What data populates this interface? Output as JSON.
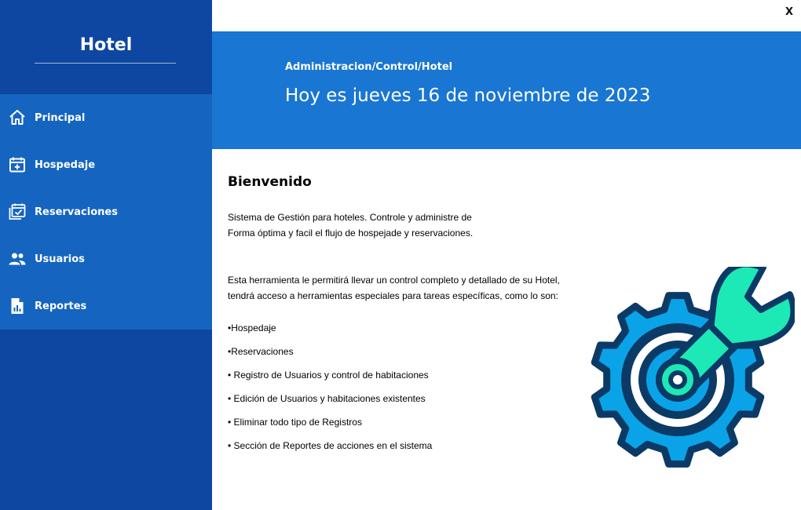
{
  "window": {
    "close_label": "X"
  },
  "sidebar": {
    "title": "Hotel",
    "items": [
      {
        "label": "Principal",
        "icon": "home-icon"
      },
      {
        "label": "Hospedaje",
        "icon": "calendar-add-icon"
      },
      {
        "label": "Reservaciones",
        "icon": "calendar-check-icon"
      },
      {
        "label": "Usuarios",
        "icon": "users-icon"
      },
      {
        "label": "Reportes",
        "icon": "report-icon"
      }
    ]
  },
  "header": {
    "breadcrumb": "Administracion/Control/Hotel",
    "date_text": "Hoy es jueves 16 de noviembre de 2023"
  },
  "main": {
    "welcome_title": "Bienvenido",
    "intro_line1": "Sistema de Gestión para hoteles. Controle y administre de",
    "intro_line2": "Forma óptima y facil el flujo de hospejade y reservaciones.",
    "tool_line1": "Esta herramienta le permitirá llevar un control completo y detallado de su Hotel,",
    "tool_line2": "tendrá acceso a herramientas especiales para tareas específicas, como lo son:",
    "features": [
      "•Hospedaje",
      "•Reservaciones",
      "• Registro de Usuarios y  control de habitaciones",
      "• Edición de Usuarios y habitaciones existentes",
      "• Eliminar todo tipo de Registros",
      "• Sección de Reportes de acciones en el sistema"
    ]
  },
  "colors": {
    "sidebar_dark": "#0d47a1",
    "sidebar_menu": "#1565c0",
    "header_blue": "#1976d2",
    "gear_light": "#0aa3e8",
    "gear_outline": "#0b3a66",
    "wrench_teal": "#1de9b6"
  },
  "illustration": {
    "icon": "gear-wrench-icon"
  }
}
